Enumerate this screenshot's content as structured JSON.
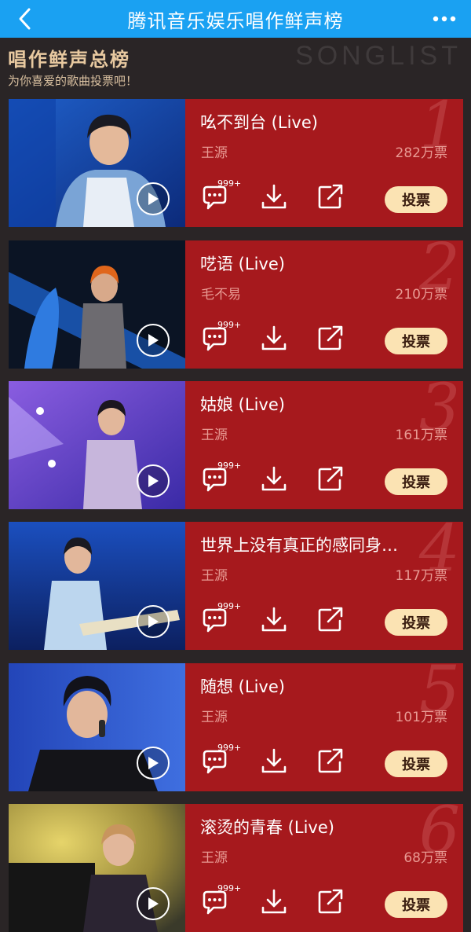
{
  "navbar": {
    "title": "腾讯音乐娱乐唱作鲜声榜",
    "back_icon": "chevron-left-icon",
    "more_icon": "ellipsis-icon"
  },
  "board": {
    "title": "唱作鲜声总榜",
    "watermark": "SONGLIST",
    "subtitle": "为你喜爱的歌曲投票吧！"
  },
  "actions": {
    "comment_badge": "999+",
    "vote_label": "投票"
  },
  "songs": [
    {
      "rank": "1",
      "title": "吆不到台 (Live)",
      "artist": "王源",
      "votes": "282万票"
    },
    {
      "rank": "2",
      "title": "呓语 (Live)",
      "artist": "毛不易",
      "votes": "210万票"
    },
    {
      "rank": "3",
      "title": "姑娘 (Live)",
      "artist": "王源",
      "votes": "161万票"
    },
    {
      "rank": "4",
      "title": "世界上没有真正的感同身…",
      "artist": "王源",
      "votes": "117万票"
    },
    {
      "rank": "5",
      "title": "随想 (Live)",
      "artist": "王源",
      "votes": "101万票"
    },
    {
      "rank": "6",
      "title": "滚烫的青春 (Live)",
      "artist": "王源",
      "votes": "68万票"
    }
  ],
  "colors": {
    "navbar": "#1aa1f2",
    "card": "#a6191d",
    "background": "#2a2526",
    "vote_button": "#fbe3b3",
    "heading": "#e8c9a0"
  }
}
